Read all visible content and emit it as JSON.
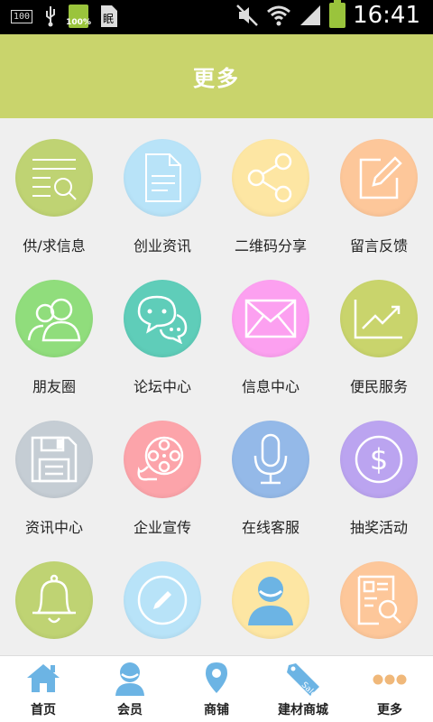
{
  "status_bar": {
    "sd_label": "100",
    "battery_small_label": "100%",
    "time": "16:41"
  },
  "header": {
    "title": "更多"
  },
  "grid": {
    "items": [
      {
        "label": "供/求信息",
        "icon": "search-list-icon",
        "color": "#bfd373"
      },
      {
        "label": "创业资讯",
        "icon": "document-icon",
        "color": "#b8e3f8"
      },
      {
        "label": "二维码分享",
        "icon": "share-icon",
        "color": "#fde6a3"
      },
      {
        "label": "留言反馈",
        "icon": "edit-icon",
        "color": "#fdc79a"
      },
      {
        "label": "朋友圈",
        "icon": "friends-icon",
        "color": "#90dd7c"
      },
      {
        "label": "论坛中心",
        "icon": "chat-icon",
        "color": "#5fcdb9"
      },
      {
        "label": "信息中心",
        "icon": "mail-icon",
        "color": "#fca0f0"
      },
      {
        "label": "便民服务",
        "icon": "trend-chart-icon",
        "color": "#c9d46c"
      },
      {
        "label": "资讯中心",
        "icon": "save-icon",
        "color": "#c5cdd4"
      },
      {
        "label": "企业宣传",
        "icon": "film-reel-icon",
        "color": "#fca4aa"
      },
      {
        "label": "在线客服",
        "icon": "microphone-icon",
        "color": "#94b9e8"
      },
      {
        "label": "抽奖活动",
        "icon": "dollar-icon",
        "color": "#bba4f0"
      },
      {
        "label": "",
        "icon": "bell-icon",
        "color": "#bfd373"
      },
      {
        "label": "",
        "icon": "pencil-circle-icon",
        "color": "#b8e3f8"
      },
      {
        "label": "",
        "icon": "user-avatar-icon",
        "color": "#fde6a3"
      },
      {
        "label": "",
        "icon": "search-document-icon",
        "color": "#fdc79a"
      }
    ]
  },
  "bottom_nav": {
    "items": [
      {
        "label": "首页",
        "icon": "home-icon"
      },
      {
        "label": "会员",
        "icon": "member-icon"
      },
      {
        "label": "商铺",
        "icon": "location-pin-icon"
      },
      {
        "label": "建材商城",
        "icon": "sale-tag-icon"
      },
      {
        "label": "更多",
        "icon": "more-dots-icon"
      }
    ],
    "accent_color": "#6cb4e4",
    "more_color": "#f0b87a"
  }
}
